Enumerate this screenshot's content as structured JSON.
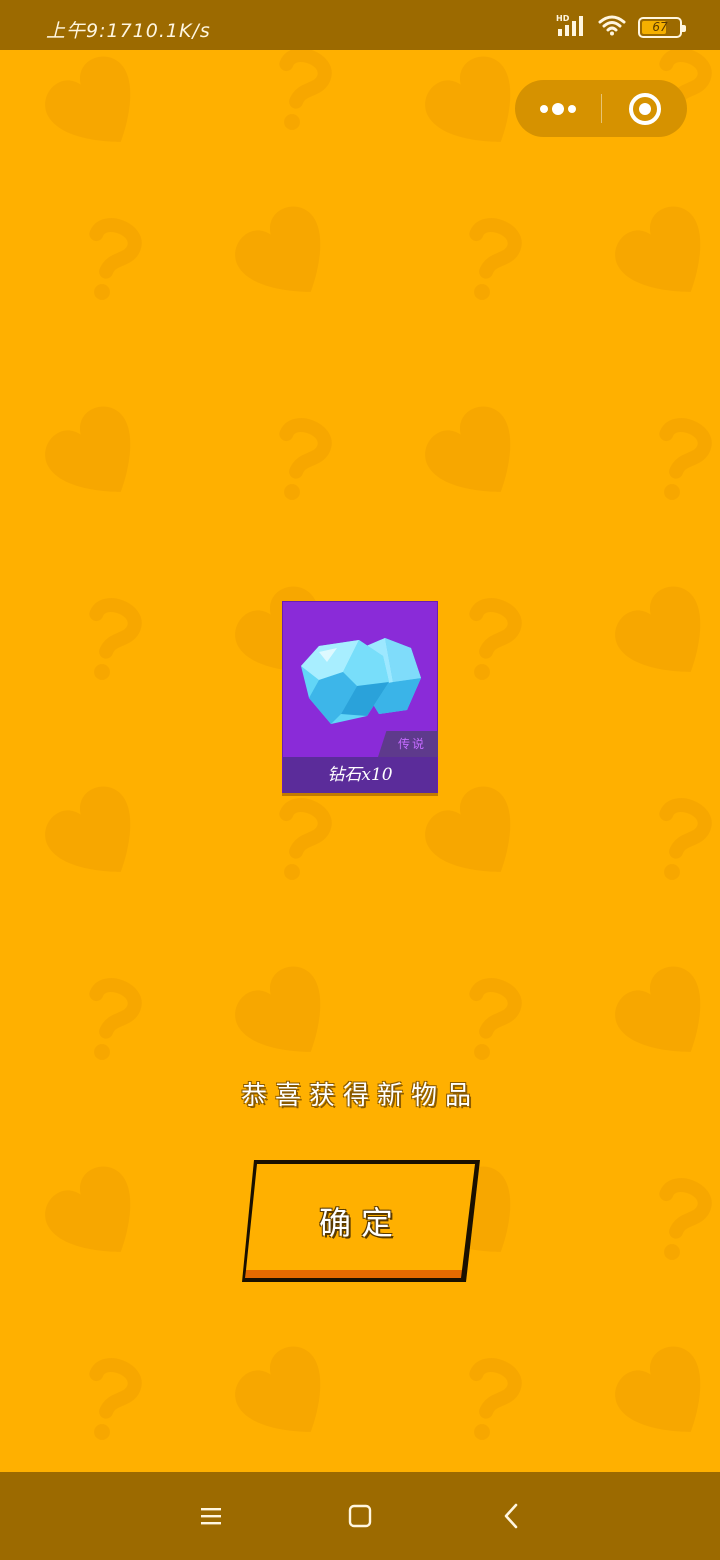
{
  "status_bar": {
    "time": "上午9:17",
    "speed": "10.1K/s",
    "network_label": "HD",
    "battery_level": "67",
    "battery_fraction": 0.67
  },
  "capsule": {
    "menu_icon": "more-dots-icon",
    "close_icon": "target-circle-icon"
  },
  "reward": {
    "item_icon": "diamond-gem-icon",
    "rarity": "传说",
    "label": "钻石x10"
  },
  "message": "恭喜获得新物品",
  "confirm_button": "确定",
  "nav_bar": {
    "menu_icon": "menu-lines-icon",
    "home_icon": "home-square-icon",
    "back_icon": "back-chevron-icon"
  },
  "colors": {
    "background": "#FFB000",
    "bars": "#9C6A00",
    "card": "#8A2BD8",
    "card_label": "#5B2C9A",
    "button": "#FFB000"
  }
}
